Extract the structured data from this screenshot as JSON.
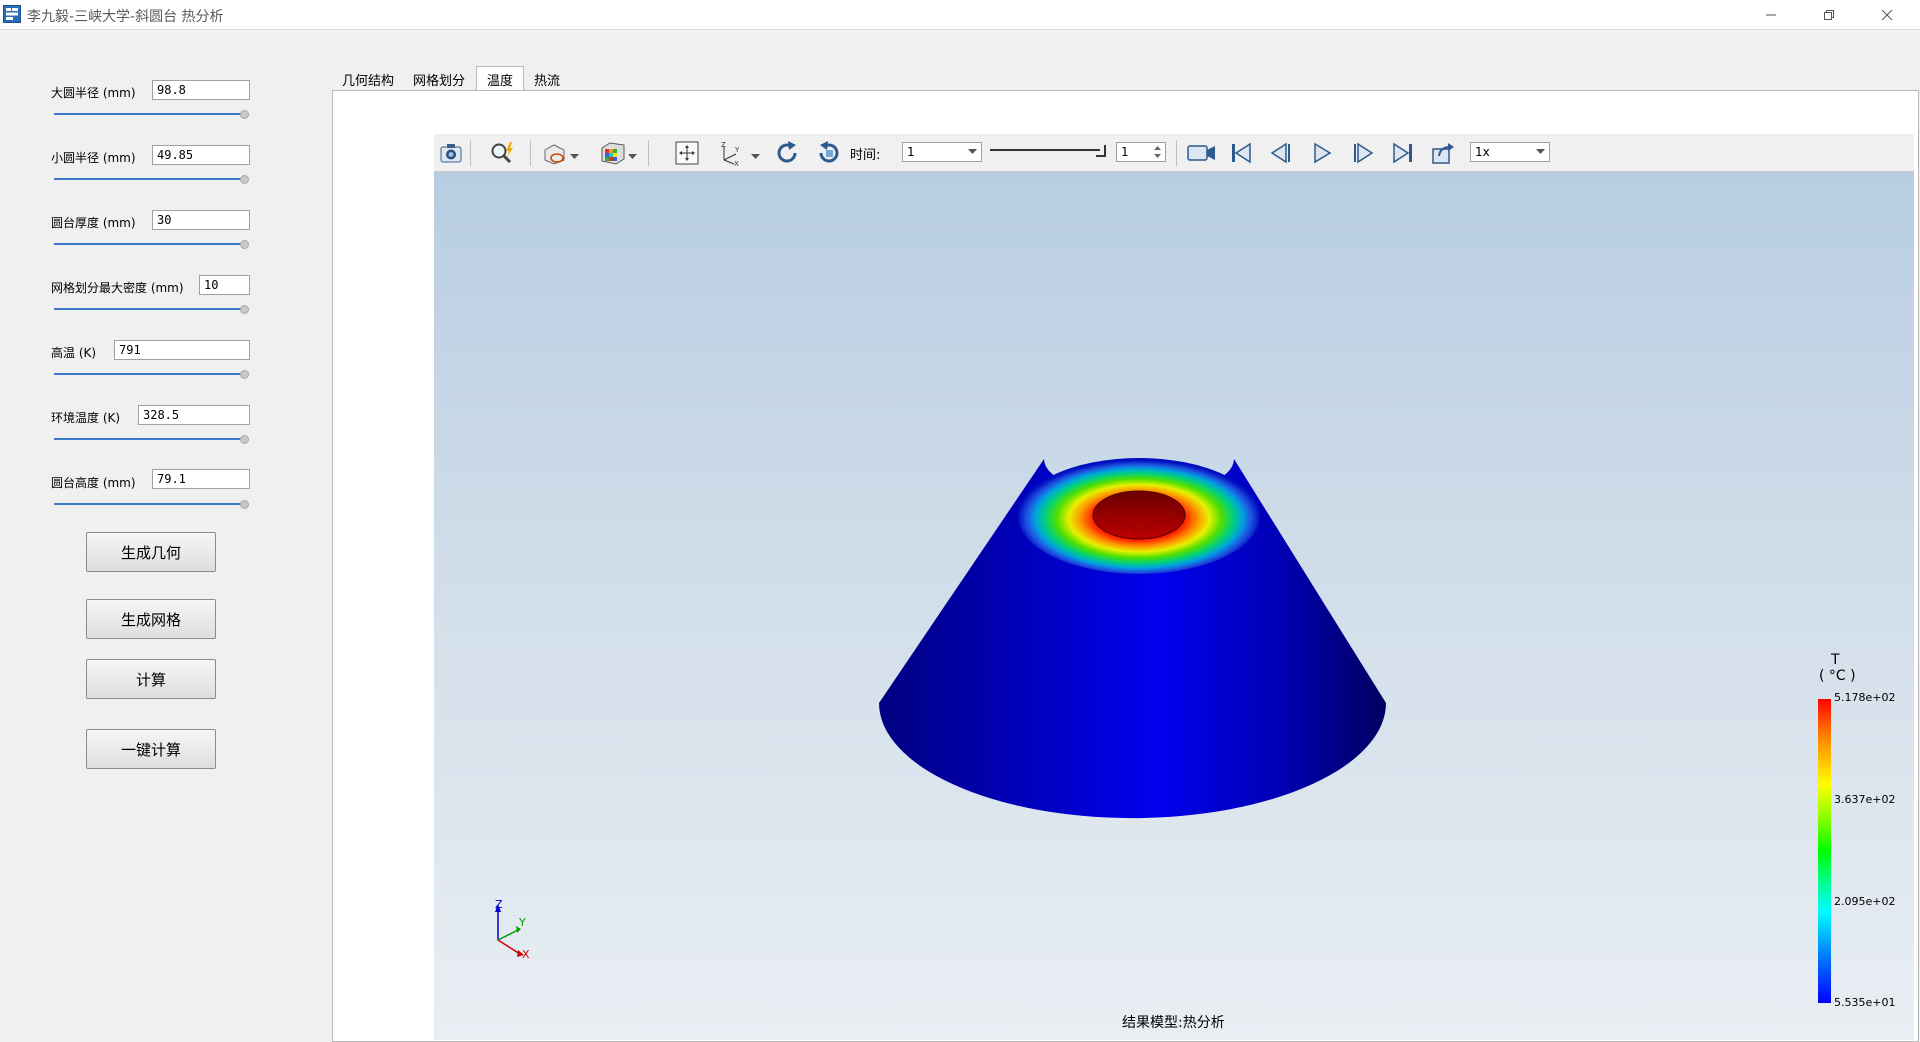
{
  "window": {
    "title": "李九毅-三峡大学-斜圆台 热分析",
    "controls": [
      "minimize",
      "maximize",
      "close"
    ]
  },
  "params": [
    {
      "label": "大圆半径 (mm)",
      "value": "98.8"
    },
    {
      "label": "小圆半径 (mm)",
      "value": "49.85"
    },
    {
      "label": "圆台厚度 (mm)",
      "value": "30"
    },
    {
      "label": "网格划分最大密度 (mm)",
      "value": "10"
    },
    {
      "label": "高温 (K)",
      "value": "791"
    },
    {
      "label": "环境温度 (K)",
      "value": "328.5"
    },
    {
      "label": "圆台高度 (mm)",
      "value": "79.1"
    }
  ],
  "buttons": {
    "gen_geometry": "生成几何",
    "gen_mesh": "生成网格",
    "compute": "计算",
    "one_click": "一键计算"
  },
  "tabs": [
    {
      "label": "几何结构",
      "active": false
    },
    {
      "label": "网格划分",
      "active": false
    },
    {
      "label": "温度",
      "active": true
    },
    {
      "label": "热流",
      "active": false
    }
  ],
  "toolbar": {
    "time_label": "时间:",
    "time_value": "1",
    "frame_value": "1",
    "speed_value": "1x",
    "icons": [
      "camera-icon",
      "zoom-icon",
      "display-mode-icon",
      "colormap-icon",
      "fit-view-icon",
      "axes-icon",
      "rotate-icon",
      "reset-view-icon",
      "record-icon",
      "first-frame-icon",
      "prev-frame-icon",
      "play-icon",
      "next-frame-icon",
      "last-frame-icon",
      "export-icon"
    ]
  },
  "viewport": {
    "caption": "结果模型:热分析",
    "axes": {
      "z": "Z",
      "y": "Y",
      "x": "X"
    }
  },
  "legend": {
    "title": "T",
    "unit": "( °C )",
    "values": [
      "5.178e+02",
      "3.637e+02",
      "2.095e+02",
      "5.535e+01"
    ],
    "colors": [
      "#ff0000",
      "#ffff00",
      "#00ff00",
      "#00ffff",
      "#0000ff"
    ]
  }
}
